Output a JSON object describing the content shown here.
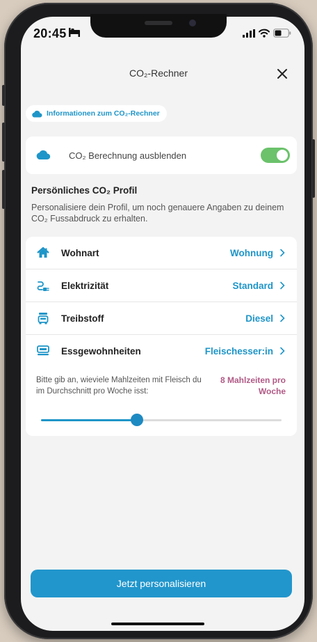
{
  "status_bar": {
    "time": "20:45"
  },
  "header": {
    "title": "CO₂-Rechner"
  },
  "info_link": {
    "label": "Informationen zum CO₂-Rechner"
  },
  "co2_toggle": {
    "label": "CO₂ Berechnung ausblenden",
    "enabled": true
  },
  "profile": {
    "title": "Persönliches CO₂ Profil",
    "description": "Personalisiere dein Profil, um noch genauere Angaben zu deinem CO₂ Fussabdruck zu erhalten."
  },
  "settings": [
    {
      "label": "Wohnart",
      "value": "Wohnung",
      "icon": "house-icon"
    },
    {
      "label": "Elektrizität",
      "value": "Standard",
      "icon": "plug-icon"
    },
    {
      "label": "Treibstoff",
      "value": "Diesel",
      "icon": "fuel-icon"
    },
    {
      "label": "Essgewohnheiten",
      "value": "Fleischesser:in",
      "icon": "food-icon"
    }
  ],
  "meals": {
    "question": "Bitte gib an, wieviele Mahlzeiten mit Fleisch du im Durchschnitt pro Woche isst:",
    "answer": "8 Mahlzeiten pro Woche",
    "slider_fraction": 0.4
  },
  "cta": {
    "label": "Jetzt personalisieren"
  },
  "colors": {
    "accent": "#1e95c8",
    "toggle_on": "#6bc26b",
    "highlight": "#b15a86"
  }
}
